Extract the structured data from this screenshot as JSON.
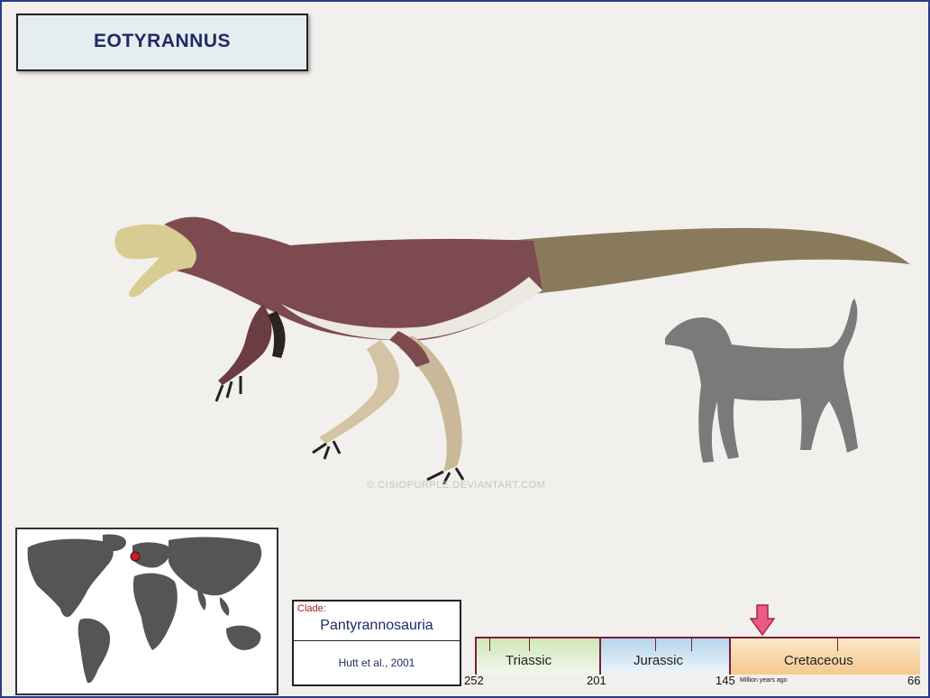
{
  "title": "EOTYRANNUS",
  "watermark": "© CISIOPURPLE.DEVIANTART.COM",
  "clade": {
    "label": "Clade:",
    "name": "Pantyrannosauria",
    "author": "Hutt et al., 2001"
  },
  "timeline": {
    "periods": [
      {
        "name": "Triassic",
        "color": "#cfe8b7"
      },
      {
        "name": "Jurassic",
        "color": "#b6d6ec"
      },
      {
        "name": "Cretaceous",
        "color": "#f5ce9a"
      }
    ],
    "ticks": [
      "252",
      "201",
      "145",
      "66"
    ],
    "unit": "Million years ago",
    "marker_color": "#e85b82",
    "border_color": "#7a1e3c"
  },
  "map": {
    "location_color": "#d11a1a"
  },
  "colors": {
    "frame": "#2b3a8a",
    "title_text": "#1e2a63",
    "body": "#7d4a50",
    "tail": "#8a7a5c"
  }
}
